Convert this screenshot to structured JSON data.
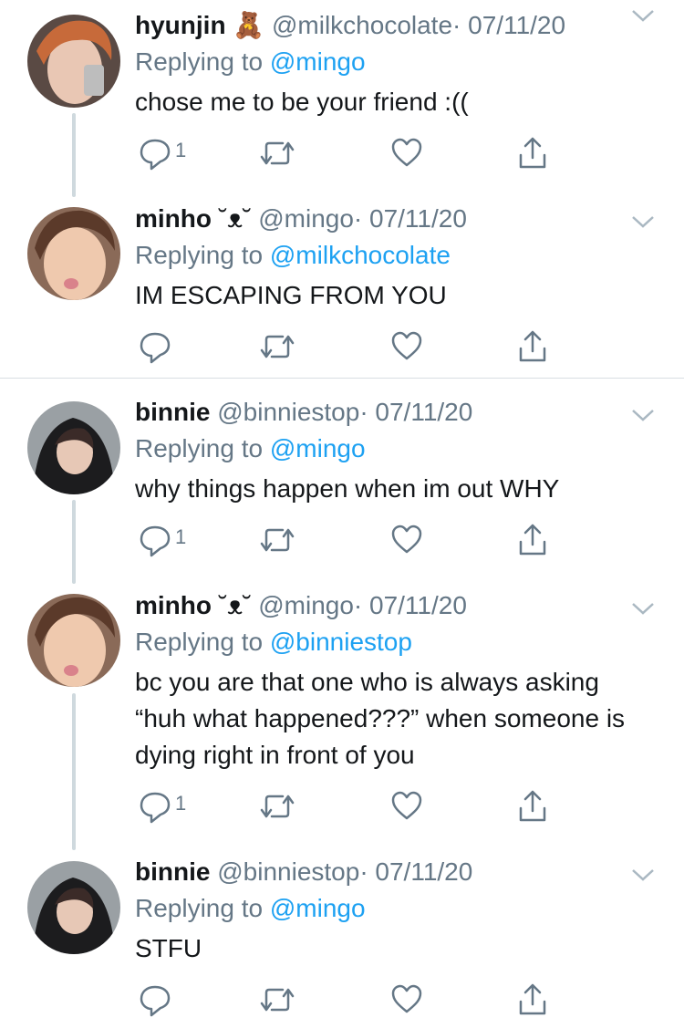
{
  "tweets": [
    {
      "name": "hyunjin",
      "emoji": "🧸",
      "handle": "@milkchocolate",
      "date": "· 07/11/20",
      "replying_label": "Replying to ",
      "replying_to": "@mingo",
      "text": "chose me to be your friend :((",
      "reply_count": "1"
    },
    {
      "name": "minho",
      "emoji": "˘ᴥ˘",
      "handle": "@mingo",
      "date": "· 07/11/20",
      "replying_label": "Replying to ",
      "replying_to": "@milkchocolate",
      "text": "IM ESCAPING FROM YOU",
      "reply_count": ""
    },
    {
      "name": "binnie",
      "emoji": "",
      "handle": "@binniestop",
      "date": "· 07/11/20",
      "replying_label": "Replying to ",
      "replying_to": "@mingo",
      "text": "why things happen when im out WHY",
      "reply_count": "1"
    },
    {
      "name": "minho",
      "emoji": "˘ᴥ˘",
      "handle": "@mingo",
      "date": "· 07/11/20",
      "replying_label": "Replying to ",
      "replying_to": "@binniestop",
      "text": "bc you are that one who is always asking “huh what happened???” when someone is dying right in front of you",
      "reply_count": "1"
    },
    {
      "name": "binnie",
      "emoji": "",
      "handle": "@binniestop",
      "date": "· 07/11/20",
      "replying_label": "Replying to ",
      "replying_to": "@mingo",
      "text": "STFU",
      "reply_count": ""
    }
  ],
  "colors": {
    "accent": "#1da1f2",
    "muted": "#657786",
    "text": "#14171a",
    "line": "#cfd9de"
  },
  "icons": [
    "reply-icon",
    "retweet-icon",
    "like-icon",
    "share-icon",
    "chevron-down-icon"
  ]
}
